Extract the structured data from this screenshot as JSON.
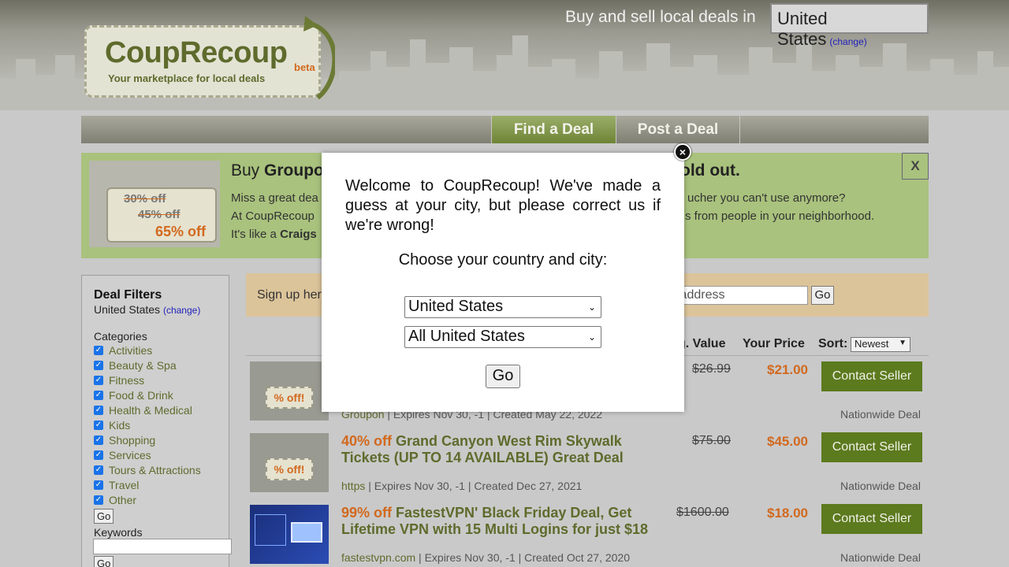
{
  "header": {
    "logo_title": "CoupRecoup",
    "logo_beta": "beta",
    "logo_tagline": "Your marketplace for local deals",
    "locale_text": "Buy and sell local deals in",
    "locale_country": "United States",
    "locale_change": "(change)"
  },
  "nav": {
    "find": "Find a Deal",
    "post": "Post a Deal"
  },
  "promo": {
    "title_prefix": "Buy ",
    "title_bold": "Groupo",
    "title_suffix": "old out.",
    "line1a": "Miss a great dea",
    "line1b": "ucher you can't use anymore?",
    "line2a": "At CoupRecoup",
    "line2b": "s from people in your neighborhood.",
    "line3a": "It's like a ",
    "line3b": "Craigs",
    "close": "X",
    "tag_old1": "30% off",
    "tag_old2": "45% off",
    "tag_new": "65% off"
  },
  "sidebar": {
    "title": "Deal Filters",
    "location": "United States",
    "change": "(change)",
    "categories_label": "Categories",
    "categories": [
      "Activities",
      "Beauty & Spa",
      "Fitness",
      "Food & Drink",
      "Health & Medical",
      "Kids",
      "Shopping",
      "Services",
      "Tours & Attractions",
      "Travel",
      "Other"
    ],
    "go": "Go",
    "keywords_label": "Keywords",
    "go2": "Go"
  },
  "signup": {
    "text": "Sign up her",
    "email_placeholder": "il address",
    "go": "Go"
  },
  "table": {
    "orig_value": "g. Value",
    "your_price": "Your Price",
    "sort_label": "Sort:",
    "sort_value": "Newest"
  },
  "deals": [
    {
      "pct": "% off!",
      "title_pct": "",
      "title": "",
      "source": "Groupon",
      "meta": " | Expires Nov 30, -1 | Created May 22, 2022",
      "orig": "$26.99",
      "price": "$21.00",
      "contact": "Contact Seller",
      "scope": "Nationwide Deal"
    },
    {
      "pct": "% off!",
      "title_pct": "40% off ",
      "title": "Grand Canyon West Rim Skywalk Tickets (UP TO 14 AVAILABLE) Great Deal",
      "source": "https",
      "meta": " | Expires Nov 30, -1 | Created Dec 27, 2021",
      "orig": "$75.00",
      "price": "$45.00",
      "contact": "Contact Seller",
      "scope": "Nationwide Deal"
    },
    {
      "pct": "",
      "title_pct": "99% off ",
      "title": "FastestVPN' Black Friday Deal, Get Lifetime VPN with 15 Multi Logins for just $18",
      "source": "fastestvpn.com",
      "meta": " | Expires Nov 30, -1 | Created Oct 27, 2020",
      "orig": "$1600.00",
      "price": "$18.00",
      "contact": "Contact Seller",
      "scope": "Nationwide Deal"
    }
  ],
  "modal": {
    "message": "Welcome to CoupRecoup! We've made a guess at your city, but please correct us if we're wrong!",
    "choose": "Choose your country and city:",
    "country": "United States",
    "city": "All United States",
    "go": "Go",
    "close": "×"
  }
}
